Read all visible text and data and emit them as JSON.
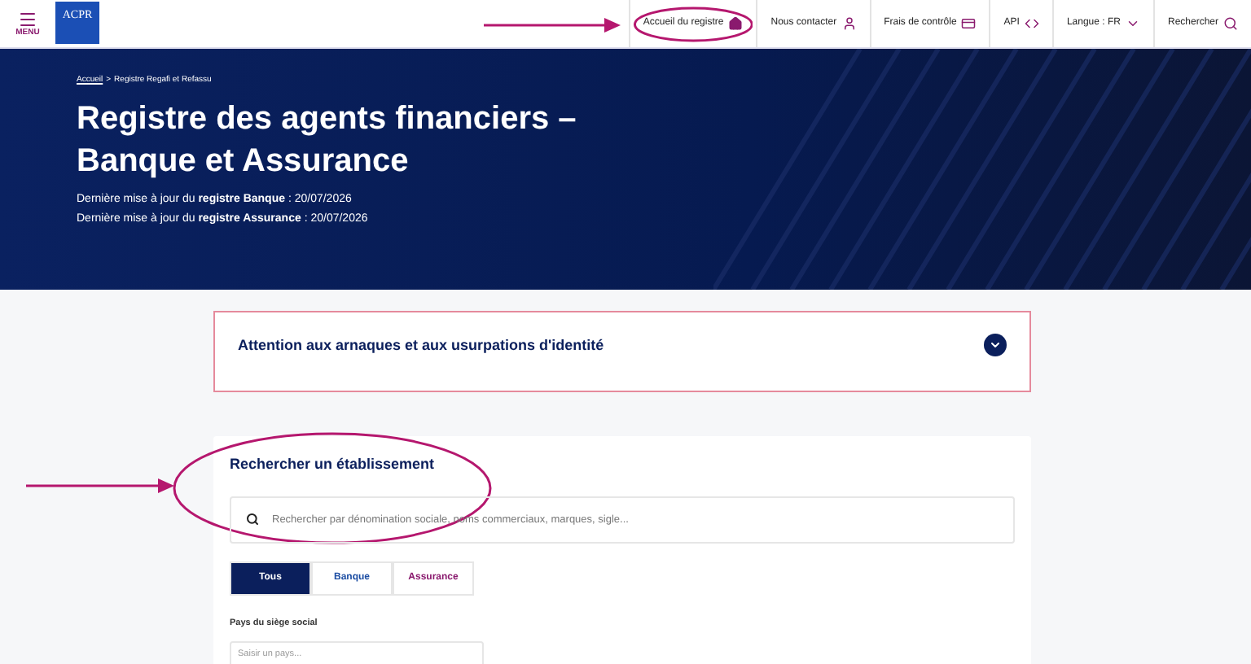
{
  "header": {
    "menu_label": "MENU",
    "logo_text": "ACPR",
    "nav": [
      {
        "label": "Accueil du registre"
      },
      {
        "label": "Nous contacter"
      },
      {
        "label": "Frais de contrôle"
      },
      {
        "label": "API"
      },
      {
        "label": "Langue : FR"
      },
      {
        "label": "Rechercher"
      }
    ]
  },
  "hero": {
    "breadcrumb": [
      {
        "label": "Accueil",
        "link": true
      },
      {
        "label": "Registre Regafi et Refassu",
        "link": false
      }
    ],
    "breadcrumb_separator": ">",
    "title": "Registre des agents financiers – Banque et Assurance",
    "updates": [
      "Dernière mise à jour du **registre Banque** : 20/07/2026",
      "Dernière mise à jour du **registre Assurance** : 20/07/2026"
    ]
  },
  "alert": {
    "title": "Attention aux arnaques et aux usurpations d'identité",
    "expanded": false
  },
  "search": {
    "title": "Rechercher un établissement",
    "placeholder": "Rechercher par dénomination sociale, noms commerciaux, marques, sigle...",
    "tabs": [
      {
        "label": "Tous",
        "selected": true,
        "color": "#ffffff"
      },
      {
        "label": "Banque",
        "selected": false,
        "color": "#1d4ea3"
      },
      {
        "label": "Assurance",
        "selected": false,
        "color": "#8a1a6e"
      }
    ],
    "country_label": "Pays du siège social",
    "country_placeholder": "Saisir un pays..."
  }
}
